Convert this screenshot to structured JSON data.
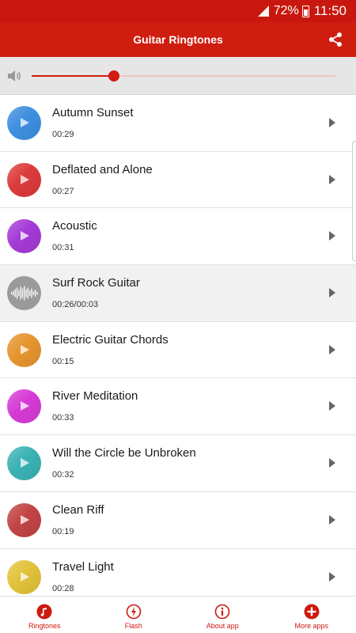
{
  "status_bar": {
    "battery": "72%",
    "time": "11:50"
  },
  "app_bar": {
    "title": "Guitar Ringtones"
  },
  "volume": {
    "level": 0.27
  },
  "ringtones": [
    {
      "name": "Autumn Sunset",
      "duration": "00:29",
      "color": "#3d8fe0"
    },
    {
      "name": "Deflated and Alone",
      "duration": "00:27",
      "color": "#dc3a3a"
    },
    {
      "name": "Acoustic",
      "duration": "00:31",
      "color": "#a43ad6"
    },
    {
      "name": "Surf Rock Guitar",
      "duration": "00:26/00:03",
      "color": "#9a9a9a",
      "playing": true
    },
    {
      "name": "Electric Guitar Chords",
      "duration": "00:15",
      "color": "#e6952e"
    },
    {
      "name": "River Meditation",
      "duration": "00:33",
      "color": "#d63ad6"
    },
    {
      "name": "Will the Circle be Unbroken",
      "duration": "00:32",
      "color": "#3ab2b4"
    },
    {
      "name": "Clean Riff",
      "duration": "00:19",
      "color": "#c24444"
    },
    {
      "name": "Travel Light",
      "duration": "00:28",
      "color": "#e2c23a"
    }
  ],
  "bottom_nav": [
    {
      "label": "Ringtones",
      "icon": "music-note-icon"
    },
    {
      "label": "Flash",
      "icon": "flash-icon"
    },
    {
      "label": "About app",
      "icon": "info-icon"
    },
    {
      "label": "More apps",
      "icon": "plus-icon"
    }
  ],
  "accent_color": "#cf1d10"
}
